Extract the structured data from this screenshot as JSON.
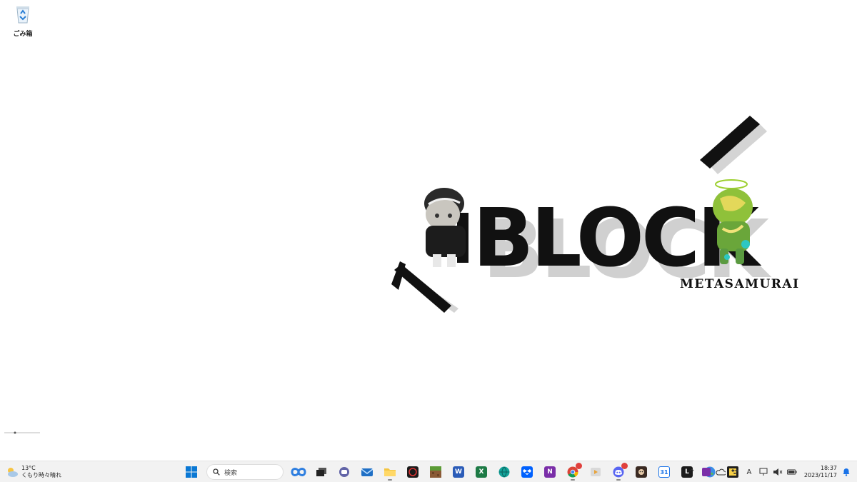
{
  "desktop": {
    "recycle_bin_label": "ごみ箱"
  },
  "wallpaper": {
    "title": "BLOCK",
    "subtitle": "METASAMURAI",
    "accent_color": "#111111",
    "shadow_color": "#cfcfcf"
  },
  "taskbar": {
    "weather": {
      "icon": "partly-cloudy-icon",
      "temp": "13°C",
      "condition": "くもり時々晴れ"
    },
    "search_placeholder": "検索",
    "apps": [
      {
        "name": "start",
        "icon": "windows-logo-icon"
      },
      {
        "name": "search",
        "icon": "search-icon"
      },
      {
        "name": "copilot",
        "icon": "copilot-icon"
      },
      {
        "name": "task-view",
        "icon": "task-view-icon"
      },
      {
        "name": "teams",
        "icon": "chat-icon"
      },
      {
        "name": "mail",
        "icon": "mail-icon"
      },
      {
        "name": "file-explorer",
        "icon": "folder-icon"
      },
      {
        "name": "media-app",
        "icon": "media-icon"
      },
      {
        "name": "minecraft",
        "icon": "minecraft-icon"
      },
      {
        "name": "word",
        "icon": "word-icon",
        "letter": "W"
      },
      {
        "name": "excel",
        "icon": "excel-icon",
        "letter": "X"
      },
      {
        "name": "globe-app",
        "icon": "globe-icon"
      },
      {
        "name": "dropbox",
        "icon": "dropbox-icon"
      },
      {
        "name": "onenote",
        "icon": "onenote-icon",
        "letter": "N"
      },
      {
        "name": "chrome",
        "icon": "chrome-icon",
        "badge": ""
      },
      {
        "name": "video-player",
        "icon": "video-icon"
      },
      {
        "name": "discord",
        "icon": "discord-icon",
        "badge": ""
      },
      {
        "name": "game-app",
        "icon": "game-icon"
      },
      {
        "name": "calendar",
        "icon": "calendar-icon",
        "letter": "31"
      },
      {
        "name": "terminal",
        "icon": "terminal-icon",
        "letter": "L"
      },
      {
        "name": "earth-app",
        "icon": "earth-icon"
      },
      {
        "name": "sticky-notes",
        "icon": "sticky-note-icon"
      }
    ],
    "tray": {
      "ime": "A",
      "time": "18:37",
      "date": "2023/11/17"
    }
  }
}
